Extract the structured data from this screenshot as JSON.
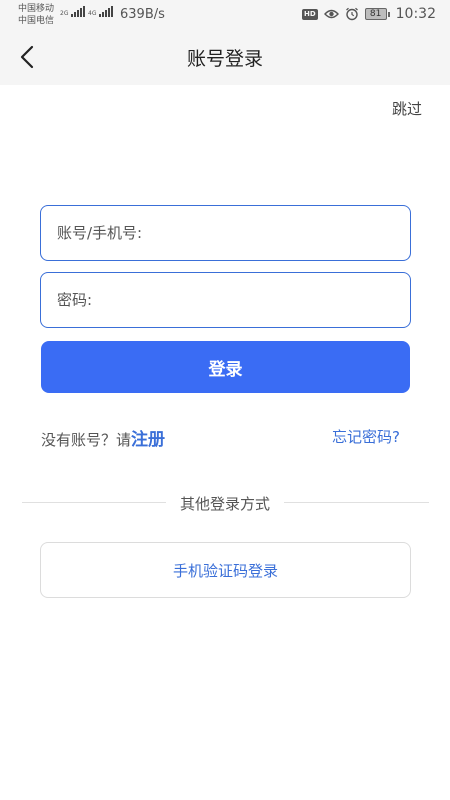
{
  "status_bar": {
    "carrier1": "中国移动",
    "carrier2": "中国电信",
    "net1": "2G",
    "net2": "4G",
    "speed": "639B/s",
    "hd": "HD",
    "battery": "81",
    "time": "10:32",
    "icons": [
      "signal-icon",
      "eye-icon",
      "alarm-icon",
      "battery-icon"
    ]
  },
  "nav": {
    "back_icon": "back-arrow-icon",
    "title": "账号登录"
  },
  "skip": "跳过",
  "form": {
    "account_placeholder": "账号/手机号:",
    "password_placeholder": "密码:",
    "login_label": "登录"
  },
  "links": {
    "no_account": "没有账号？请",
    "register": "注册",
    "forgot": "忘记密码?"
  },
  "other": {
    "divider_text": "其他登录方式",
    "sms_login": "手机验证码登录"
  },
  "colors": {
    "accent": "#3a6cf4",
    "link": "#3a6fd8",
    "header_bg": "#f5f5f5"
  }
}
